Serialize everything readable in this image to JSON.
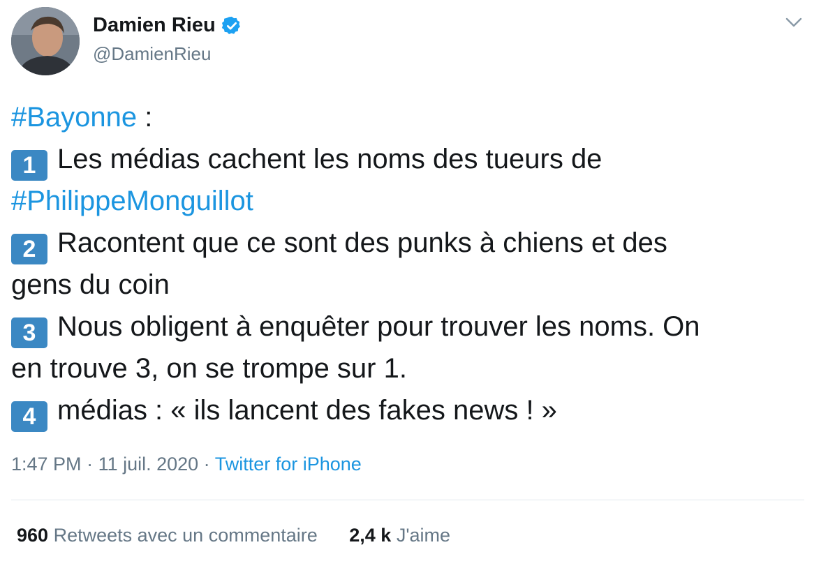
{
  "author": {
    "name": "Damien Rieu",
    "handle": "@DamienRieu",
    "verified_icon": "verified-badge-icon"
  },
  "menu_icon": "chevron-down-icon",
  "tweet": {
    "hashtag_bayonne": "#Bayonne",
    "colon": " :",
    "item1_key": "1",
    "item1_text": "Les médias cachent les noms des tueurs de",
    "hashtag_philippe": "#PhilippeMonguillot",
    "item2_key": "2",
    "item2_text": "Racontent que ce sont des punks à chiens et des",
    "item2_text_cont": "gens du coin",
    "item3_key": "3",
    "item3_text": "Nous obligent à enquêter pour trouver les noms. On",
    "item3_text_cont": "en trouve 3, on se trompe sur 1.",
    "item4_key": "4",
    "item4_text": "médias : « ils lancent des fakes news ! »"
  },
  "meta": {
    "time": "1:47 PM",
    "separator": " · ",
    "date": "11 juil. 2020",
    "source": "Twitter for iPhone"
  },
  "stats": {
    "retweets_count": "960",
    "retweets_label": "Retweets avec un commentaire",
    "likes_count": "2,4 k",
    "likes_label": "J'aime"
  },
  "colors": {
    "link": "#1b95e0",
    "keycap": "#3b88c3",
    "secondary_text": "#657786"
  }
}
